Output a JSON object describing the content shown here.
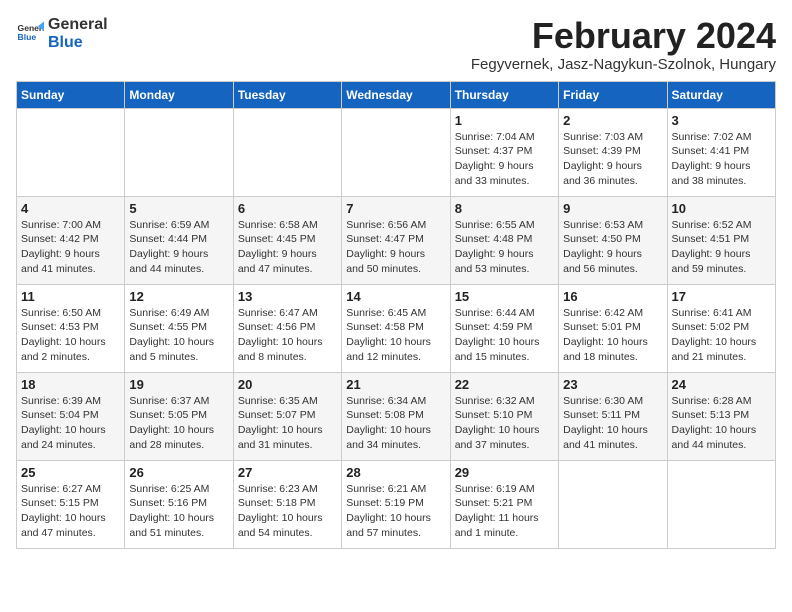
{
  "header": {
    "logo_line1": "General",
    "logo_line2": "Blue",
    "title": "February 2024",
    "subtitle": "Fegyvernek, Jasz-Nagykun-Szolnok, Hungary"
  },
  "days_of_week": [
    "Sunday",
    "Monday",
    "Tuesday",
    "Wednesday",
    "Thursday",
    "Friday",
    "Saturday"
  ],
  "weeks": [
    [
      {
        "day": "",
        "info": ""
      },
      {
        "day": "",
        "info": ""
      },
      {
        "day": "",
        "info": ""
      },
      {
        "day": "",
        "info": ""
      },
      {
        "day": "1",
        "info": "Sunrise: 7:04 AM\nSunset: 4:37 PM\nDaylight: 9 hours\nand 33 minutes."
      },
      {
        "day": "2",
        "info": "Sunrise: 7:03 AM\nSunset: 4:39 PM\nDaylight: 9 hours\nand 36 minutes."
      },
      {
        "day": "3",
        "info": "Sunrise: 7:02 AM\nSunset: 4:41 PM\nDaylight: 9 hours\nand 38 minutes."
      }
    ],
    [
      {
        "day": "4",
        "info": "Sunrise: 7:00 AM\nSunset: 4:42 PM\nDaylight: 9 hours\nand 41 minutes."
      },
      {
        "day": "5",
        "info": "Sunrise: 6:59 AM\nSunset: 4:44 PM\nDaylight: 9 hours\nand 44 minutes."
      },
      {
        "day": "6",
        "info": "Sunrise: 6:58 AM\nSunset: 4:45 PM\nDaylight: 9 hours\nand 47 minutes."
      },
      {
        "day": "7",
        "info": "Sunrise: 6:56 AM\nSunset: 4:47 PM\nDaylight: 9 hours\nand 50 minutes."
      },
      {
        "day": "8",
        "info": "Sunrise: 6:55 AM\nSunset: 4:48 PM\nDaylight: 9 hours\nand 53 minutes."
      },
      {
        "day": "9",
        "info": "Sunrise: 6:53 AM\nSunset: 4:50 PM\nDaylight: 9 hours\nand 56 minutes."
      },
      {
        "day": "10",
        "info": "Sunrise: 6:52 AM\nSunset: 4:51 PM\nDaylight: 9 hours\nand 59 minutes."
      }
    ],
    [
      {
        "day": "11",
        "info": "Sunrise: 6:50 AM\nSunset: 4:53 PM\nDaylight: 10 hours\nand 2 minutes."
      },
      {
        "day": "12",
        "info": "Sunrise: 6:49 AM\nSunset: 4:55 PM\nDaylight: 10 hours\nand 5 minutes."
      },
      {
        "day": "13",
        "info": "Sunrise: 6:47 AM\nSunset: 4:56 PM\nDaylight: 10 hours\nand 8 minutes."
      },
      {
        "day": "14",
        "info": "Sunrise: 6:45 AM\nSunset: 4:58 PM\nDaylight: 10 hours\nand 12 minutes."
      },
      {
        "day": "15",
        "info": "Sunrise: 6:44 AM\nSunset: 4:59 PM\nDaylight: 10 hours\nand 15 minutes."
      },
      {
        "day": "16",
        "info": "Sunrise: 6:42 AM\nSunset: 5:01 PM\nDaylight: 10 hours\nand 18 minutes."
      },
      {
        "day": "17",
        "info": "Sunrise: 6:41 AM\nSunset: 5:02 PM\nDaylight: 10 hours\nand 21 minutes."
      }
    ],
    [
      {
        "day": "18",
        "info": "Sunrise: 6:39 AM\nSunset: 5:04 PM\nDaylight: 10 hours\nand 24 minutes."
      },
      {
        "day": "19",
        "info": "Sunrise: 6:37 AM\nSunset: 5:05 PM\nDaylight: 10 hours\nand 28 minutes."
      },
      {
        "day": "20",
        "info": "Sunrise: 6:35 AM\nSunset: 5:07 PM\nDaylight: 10 hours\nand 31 minutes."
      },
      {
        "day": "21",
        "info": "Sunrise: 6:34 AM\nSunset: 5:08 PM\nDaylight: 10 hours\nand 34 minutes."
      },
      {
        "day": "22",
        "info": "Sunrise: 6:32 AM\nSunset: 5:10 PM\nDaylight: 10 hours\nand 37 minutes."
      },
      {
        "day": "23",
        "info": "Sunrise: 6:30 AM\nSunset: 5:11 PM\nDaylight: 10 hours\nand 41 minutes."
      },
      {
        "day": "24",
        "info": "Sunrise: 6:28 AM\nSunset: 5:13 PM\nDaylight: 10 hours\nand 44 minutes."
      }
    ],
    [
      {
        "day": "25",
        "info": "Sunrise: 6:27 AM\nSunset: 5:15 PM\nDaylight: 10 hours\nand 47 minutes."
      },
      {
        "day": "26",
        "info": "Sunrise: 6:25 AM\nSunset: 5:16 PM\nDaylight: 10 hours\nand 51 minutes."
      },
      {
        "day": "27",
        "info": "Sunrise: 6:23 AM\nSunset: 5:18 PM\nDaylight: 10 hours\nand 54 minutes."
      },
      {
        "day": "28",
        "info": "Sunrise: 6:21 AM\nSunset: 5:19 PM\nDaylight: 10 hours\nand 57 minutes."
      },
      {
        "day": "29",
        "info": "Sunrise: 6:19 AM\nSunset: 5:21 PM\nDaylight: 11 hours\nand 1 minute."
      },
      {
        "day": "",
        "info": ""
      },
      {
        "day": "",
        "info": ""
      }
    ]
  ]
}
